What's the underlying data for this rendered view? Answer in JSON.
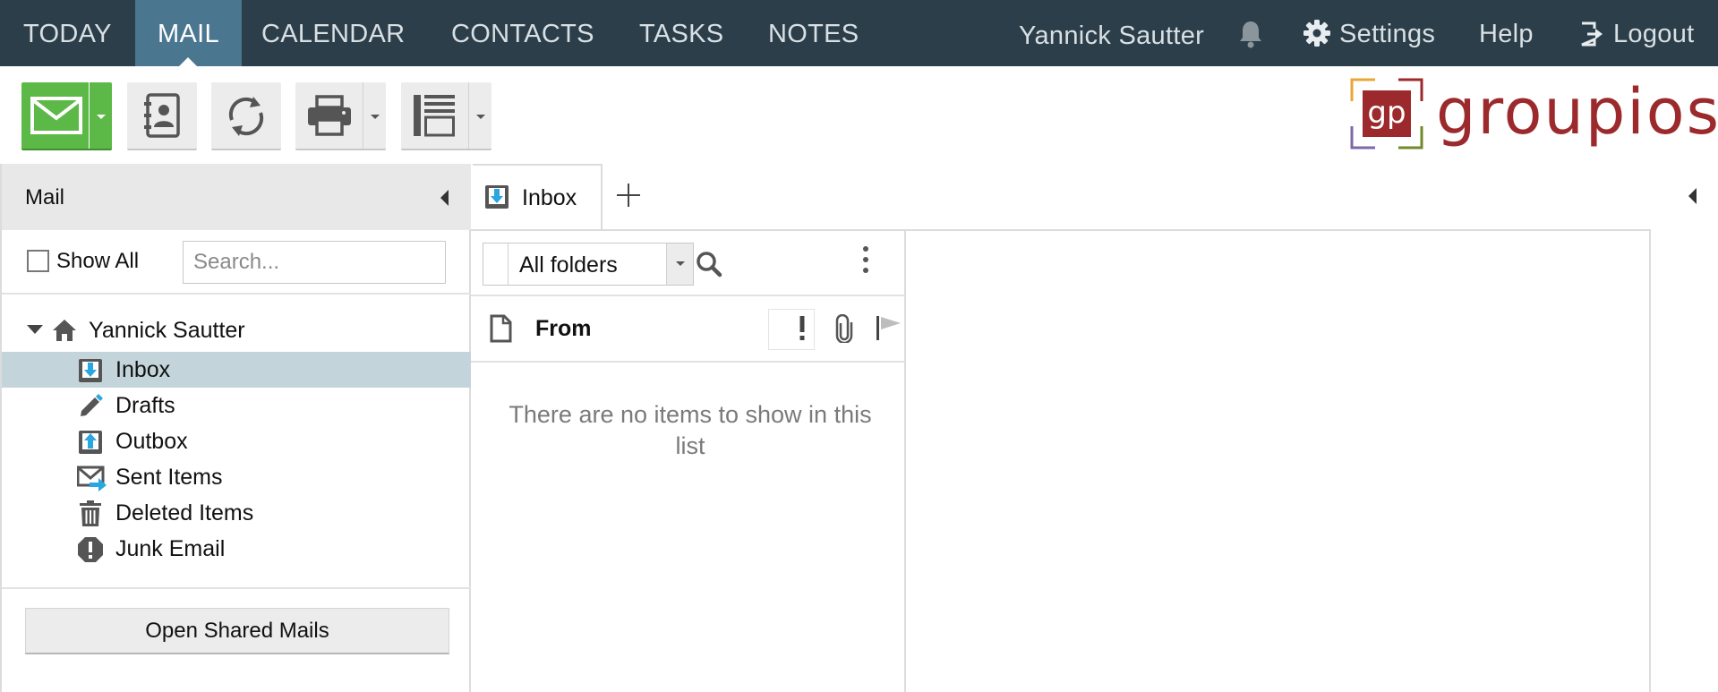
{
  "topnav": {
    "items": [
      {
        "label": "TODAY"
      },
      {
        "label": "MAIL",
        "active": true
      },
      {
        "label": "CALENDAR"
      },
      {
        "label": "CONTACTS"
      },
      {
        "label": "TASKS"
      },
      {
        "label": "NOTES"
      }
    ],
    "user_name": "Yannick Sautter",
    "notification_icon": "bell-icon",
    "settings_label": "Settings",
    "settings_icon": "gear-icon",
    "help_label": "Help",
    "logout_label": "Logout",
    "logout_icon": "logout-icon"
  },
  "toolbar": {
    "buttons": [
      {
        "name": "new-mail",
        "icon": "envelope-icon",
        "has_dropdown": true
      },
      {
        "name": "address-book",
        "icon": "contact-book-icon",
        "has_dropdown": false
      },
      {
        "name": "sync",
        "icon": "refresh-icon",
        "has_dropdown": false
      },
      {
        "name": "print",
        "icon": "printer-icon",
        "has_dropdown": true
      },
      {
        "name": "layout",
        "icon": "reading-pane-layout-icon",
        "has_dropdown": true
      }
    ]
  },
  "logo": {
    "text": "groupios",
    "mark": "gp"
  },
  "sidebar": {
    "title": "Mail",
    "show_all_label": "Show All",
    "show_all_checked": false,
    "search_placeholder": "Search...",
    "account": "Yannick Sautter",
    "folders": [
      {
        "label": "Inbox",
        "icon": "inbox-icon",
        "selected": true
      },
      {
        "label": "Drafts",
        "icon": "pencil-icon"
      },
      {
        "label": "Outbox",
        "icon": "outbox-icon"
      },
      {
        "label": "Sent Items",
        "icon": "sent-mail-icon"
      },
      {
        "label": "Deleted Items",
        "icon": "trash-icon"
      },
      {
        "label": "Junk Email",
        "icon": "junk-exclamation-icon"
      }
    ],
    "open_shared_label": "Open Shared Mails"
  },
  "tabs": {
    "active_label": "Inbox",
    "add_icon": "plus-icon"
  },
  "mail_list": {
    "folder_filter": "All folders",
    "columns": {
      "from": "From"
    },
    "empty_message": "There are no items to show in this list"
  },
  "colors": {
    "nav_bg": "#2b3e4a",
    "nav_active": "#4a7690",
    "new_mail_green": "#5cb947",
    "selected_folder": "#c3d5db",
    "accent_blue": "#2aa6e0",
    "logo_red": "#9c2a2c"
  }
}
